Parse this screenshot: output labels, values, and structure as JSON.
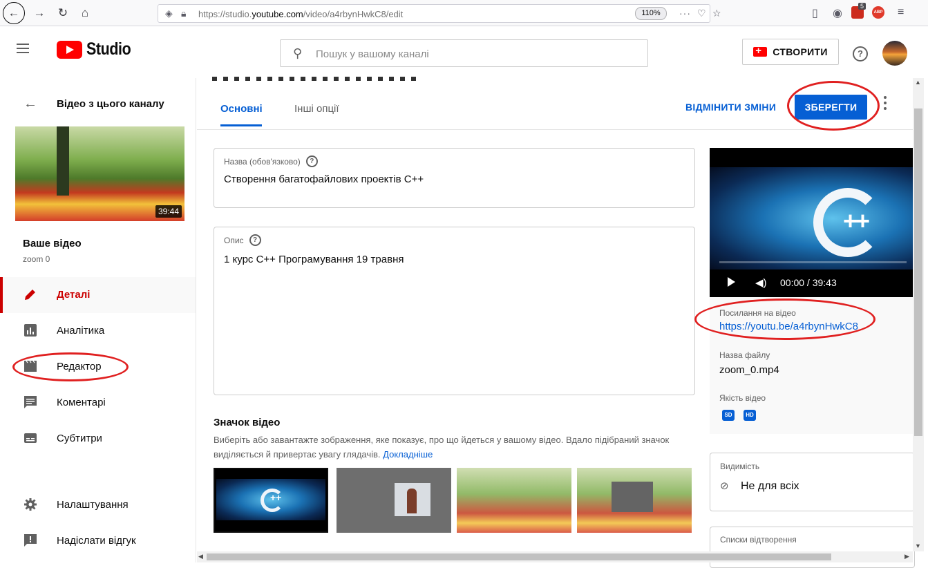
{
  "browser": {
    "url_prefix": "https://studio.",
    "url_domain": "youtube.com",
    "url_path": "/video/a4rbynHwkC8/edit",
    "zoom": "110%",
    "notification_count": "5"
  },
  "header": {
    "logo_text": "Studio",
    "search_placeholder": "Пошук у вашому каналі",
    "create_label": "СТВОРИТИ"
  },
  "sidebar": {
    "back_label": "Відео з цього каналу",
    "thumb_duration": "39:44",
    "your_video_label": "Ваше відео",
    "video_name": "zoom 0",
    "items": [
      {
        "label": "Деталі",
        "icon": "pencil-icon"
      },
      {
        "label": "Аналітика",
        "icon": "analytics-icon"
      },
      {
        "label": "Редактор",
        "icon": "clapperboard-icon"
      },
      {
        "label": "Коментарі",
        "icon": "comment-icon"
      },
      {
        "label": "Субтитри",
        "icon": "subtitles-icon"
      },
      {
        "label": "Налаштування",
        "icon": "gear-icon"
      },
      {
        "label": "Надіслати відгук",
        "icon": "feedback-icon"
      }
    ]
  },
  "tabs": {
    "basic": "Основні",
    "other": "Інші опції"
  },
  "actions": {
    "undo": "ВІДМІНИТИ ЗМІНИ",
    "save": "ЗБЕРЕГТИ"
  },
  "form": {
    "title_label": "Назва (обов'язково)",
    "title_value": "Створення багатофайлових проектів С++",
    "desc_label": "Опис",
    "desc_value": "1 курс С++ Програмування 19 травня"
  },
  "thumbnails": {
    "heading": "Значок відео",
    "description": "Виберіть або завантажте зображення, яке показує, про що йдеться у вашому відео. Вдало підібраний значок виділяється й привертає увагу глядачів.",
    "learn_more": "Докладніше"
  },
  "player": {
    "time": "00:00 / 39:43"
  },
  "details": {
    "link_label": "Посилання на відео",
    "link_value": "https://youtu.be/a4rbynHwkC8",
    "file_label": "Назва файлу",
    "file_value": "zoom_0.mp4",
    "quality_label": "Якість відео",
    "quality_sd": "SD",
    "quality_hd": "HD"
  },
  "visibility": {
    "label": "Видимість",
    "value": "Не для всіх"
  },
  "playlists": {
    "label": "Списки відтворення"
  },
  "colors": {
    "accent": "#065fd4",
    "brand_red": "#ff0000",
    "annotation_red": "#e02020"
  }
}
